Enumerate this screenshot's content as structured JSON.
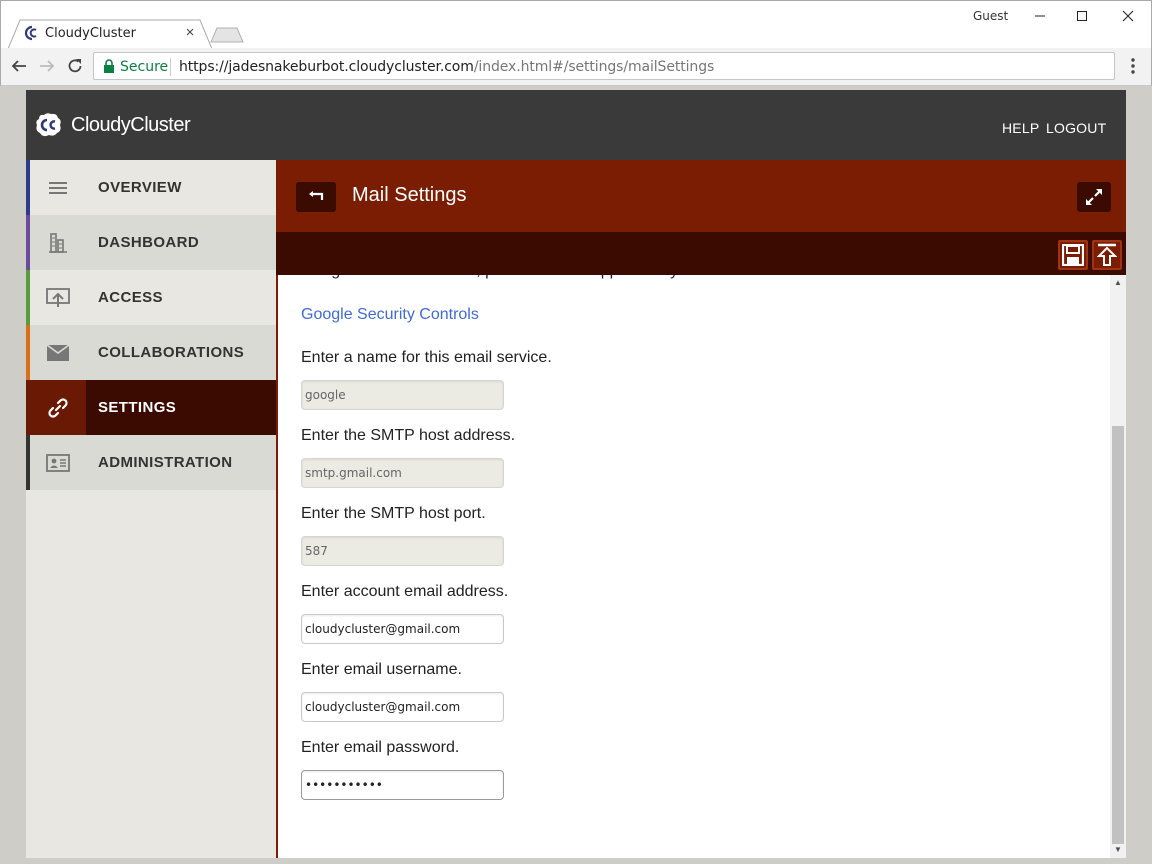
{
  "browser": {
    "tab_title": "CloudyCluster",
    "tab_close": "×",
    "profile": "Guest",
    "secure_label": "Secure",
    "url_host": "https://jadesnakeburbot.cloudycluster.com",
    "url_path": "/index.html#/settings/mailSettings"
  },
  "app": {
    "logo_text": "CloudyCluster",
    "header_links": {
      "help": "HELP",
      "logout": "LOGOUT"
    }
  },
  "sidebar": {
    "items": [
      {
        "label": "OVERVIEW",
        "icon": "menu-lines-icon",
        "accent": "#2e3a8c"
      },
      {
        "label": "DASHBOARD",
        "icon": "dashboard-icon",
        "accent": "#6a4b9c"
      },
      {
        "label": "ACCESS",
        "icon": "access-upload-icon",
        "accent": "#5a9c3c"
      },
      {
        "label": "COLLABORATIONS",
        "icon": "envelope-icon",
        "accent": "#d8701a"
      },
      {
        "label": "SETTINGS",
        "icon": "link-icon",
        "accent": "#6a1905",
        "active": true
      },
      {
        "label": "ADMINISTRATION",
        "icon": "id-card-icon",
        "accent": "#333333"
      }
    ]
  },
  "panel": {
    "title": "Mail Settings",
    "clipped_text": "Google as a mail service, please disable app security.",
    "security_link": "Google Security Controls"
  },
  "form": {
    "fields": [
      {
        "label": "Enter a name for this email service.",
        "value": "google",
        "disabled": true
      },
      {
        "label": "Enter the SMTP host address.",
        "value": "smtp.gmail.com",
        "disabled": true
      },
      {
        "label": "Enter the SMTP host port.",
        "value": "587",
        "disabled": true
      },
      {
        "label": "Enter account email address.",
        "value": "cloudycluster@gmail.com",
        "disabled": false
      },
      {
        "label": "Enter email username.",
        "value": "cloudycluster@gmail.com",
        "disabled": false
      },
      {
        "label": "Enter email password.",
        "value": "•••••••••••",
        "disabled": false
      }
    ]
  },
  "colors": {
    "header_bg": "#3a3a3a",
    "panel_head": "#7a1d03",
    "panel_bar": "#3b0b02",
    "link": "#3f6ad8"
  }
}
